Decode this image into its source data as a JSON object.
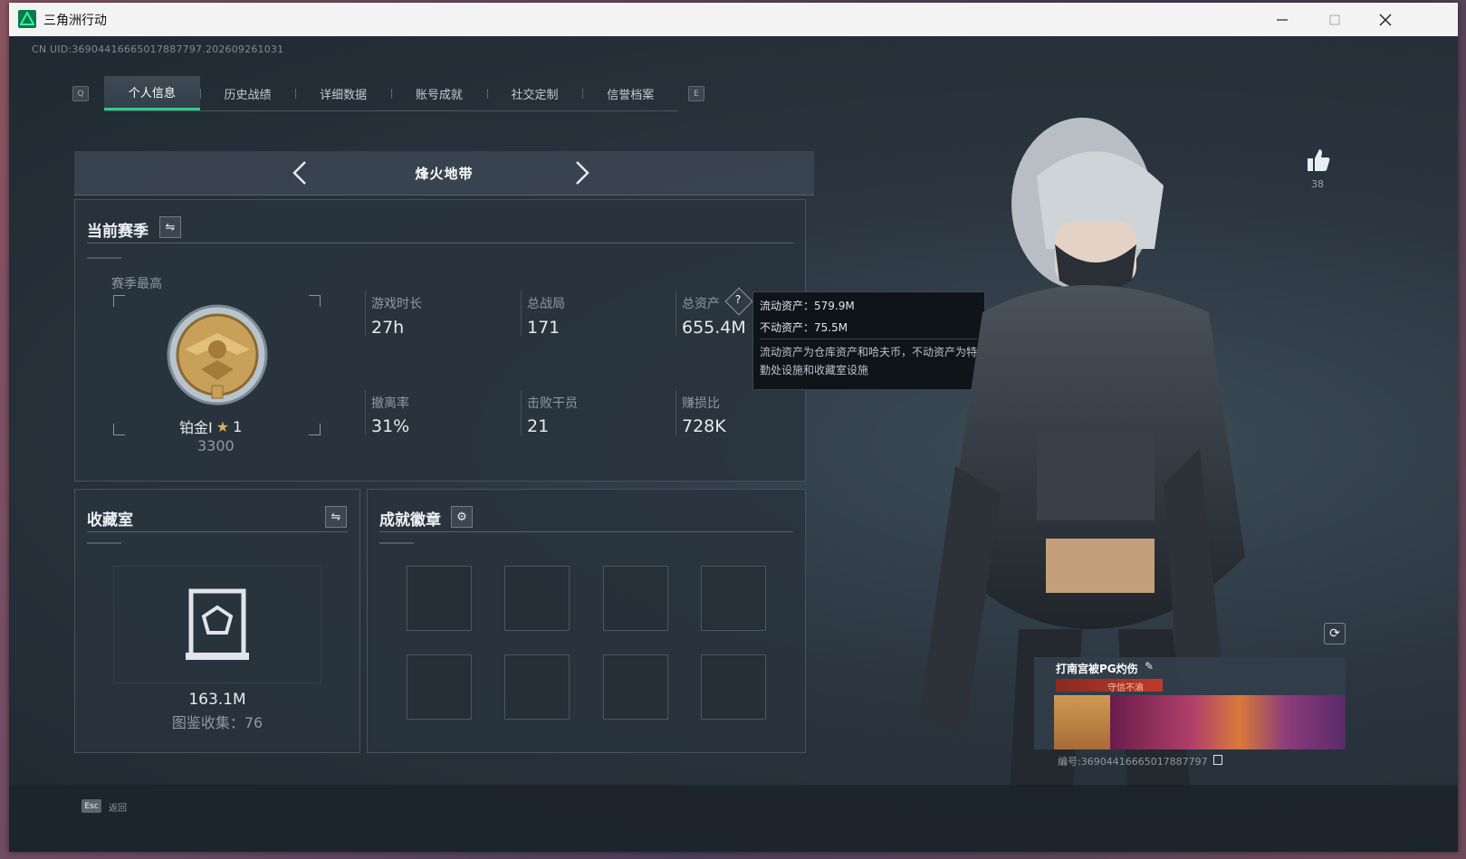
{
  "window": {
    "title": "三角洲行动"
  },
  "uid_line": "CN UID:3690441666501788779​7.202609261031",
  "tabs": {
    "left_key": "Q",
    "right_key": "E",
    "items": [
      {
        "label": "个人信息",
        "active": true
      },
      {
        "label": "历史战绩"
      },
      {
        "label": "详细数据"
      },
      {
        "label": "账号成就"
      },
      {
        "label": "社交定制"
      },
      {
        "label": "信誉档案"
      }
    ]
  },
  "mode": {
    "name": "烽火地带"
  },
  "season": {
    "title": "当前赛季",
    "best_label": "赛季最高",
    "rank_name": "铂金I",
    "rank_stars": "1",
    "rank_points": "3300",
    "stats": [
      {
        "label": "游戏时长",
        "value": "27h"
      },
      {
        "label": "总战局",
        "value": "171"
      },
      {
        "label": "总资产",
        "value": "655.4M",
        "help": "?"
      },
      {
        "label": "撤离率",
        "value": "31%"
      },
      {
        "label": "击败干员",
        "value": "21"
      },
      {
        "label": "赚损比",
        "value": "728K"
      }
    ]
  },
  "tooltip": {
    "liquid": "流动资产：579.9M",
    "fixed": "不动资产：75.5M",
    "note": "流动资产为仓库资产和哈夫币，不动资产为特勤处设施和收藏室设施"
  },
  "collection": {
    "title": "收藏室",
    "value": "163.1M",
    "count_text": "图鉴收集：76"
  },
  "badges": {
    "title": "成就徽章"
  },
  "bottom": {
    "esc_key": "Esc",
    "back_label": "返回"
  },
  "profile": {
    "likes": "38",
    "name": "打南宫被PG灼伤",
    "badge_text": "守信不渝",
    "id_text": "编号:3690441666501788779​7"
  },
  "colors": {
    "accent": "#2ecb87",
    "panel_bg": "#28333d",
    "tooltip_bg": "#0f1419"
  }
}
